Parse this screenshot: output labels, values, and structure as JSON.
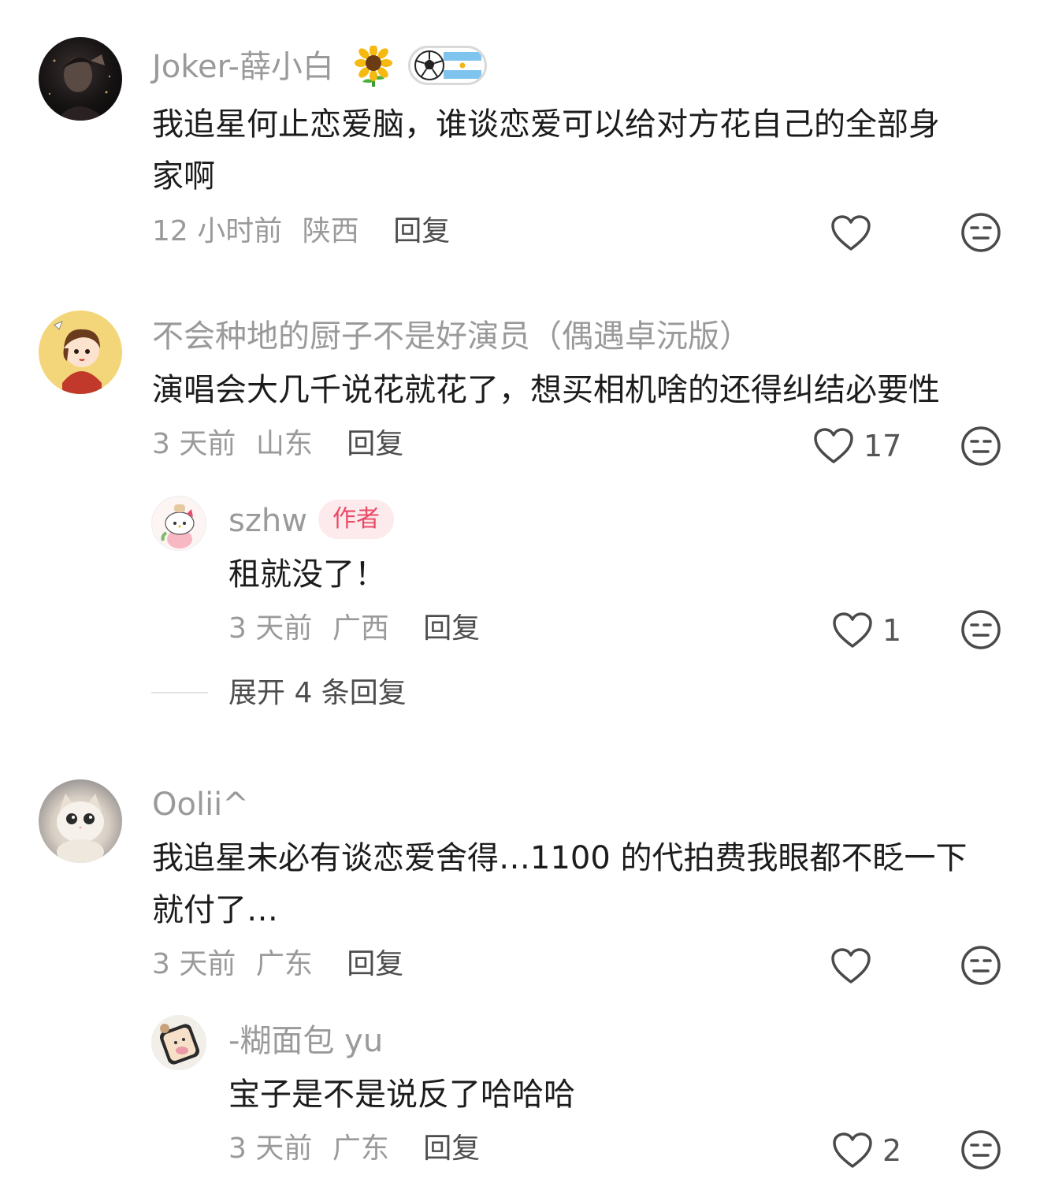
{
  "comments": [
    {
      "username": "Joker-薛小白",
      "text_lines": [
        "我追星何止恋爱脑，谁谈恋爱可以给对方花自己的全部身",
        "家啊"
      ],
      "time": "12 小时前",
      "location": "陕西",
      "reply_label": "回复",
      "likes": ""
    },
    {
      "username": "不会种地的厨子不是好演员（偶遇卓沅版）",
      "text_lines": [
        "演唱会大几千说花就花了，想买相机啥的还得纠结必要性"
      ],
      "time": "3 天前",
      "location": "山东",
      "reply_label": "回复",
      "likes": "17",
      "replies": [
        {
          "username": "szhw",
          "badge": "作者",
          "text_lines": [
            "租就没了！"
          ],
          "time": "3 天前",
          "location": "广西",
          "reply_label": "回复",
          "likes": "1"
        }
      ],
      "expand_label": "展开 4 条回复"
    },
    {
      "username": "Oolii^",
      "text_lines": [
        "我追星未必有谈恋爱舍得…1100 的代拍费我眼都不眨一下",
        "就付了…"
      ],
      "time": "3 天前",
      "location": "广东",
      "reply_label": "回复",
      "likes": "",
      "replies": [
        {
          "username": "-糊面包 yu",
          "text_lines": [
            "宝子是不是说反了哈哈哈"
          ],
          "time": "3 天前",
          "location": "广东",
          "reply_label": "回复",
          "likes": "2"
        }
      ]
    }
  ],
  "colors": {
    "author_badge_bg": "#fdeaed",
    "author_badge_text": "#e94a66"
  },
  "icons": [
    "heart-icon",
    "dislike-face-icon",
    "sunflower-emoji",
    "football-argentina-badge"
  ]
}
